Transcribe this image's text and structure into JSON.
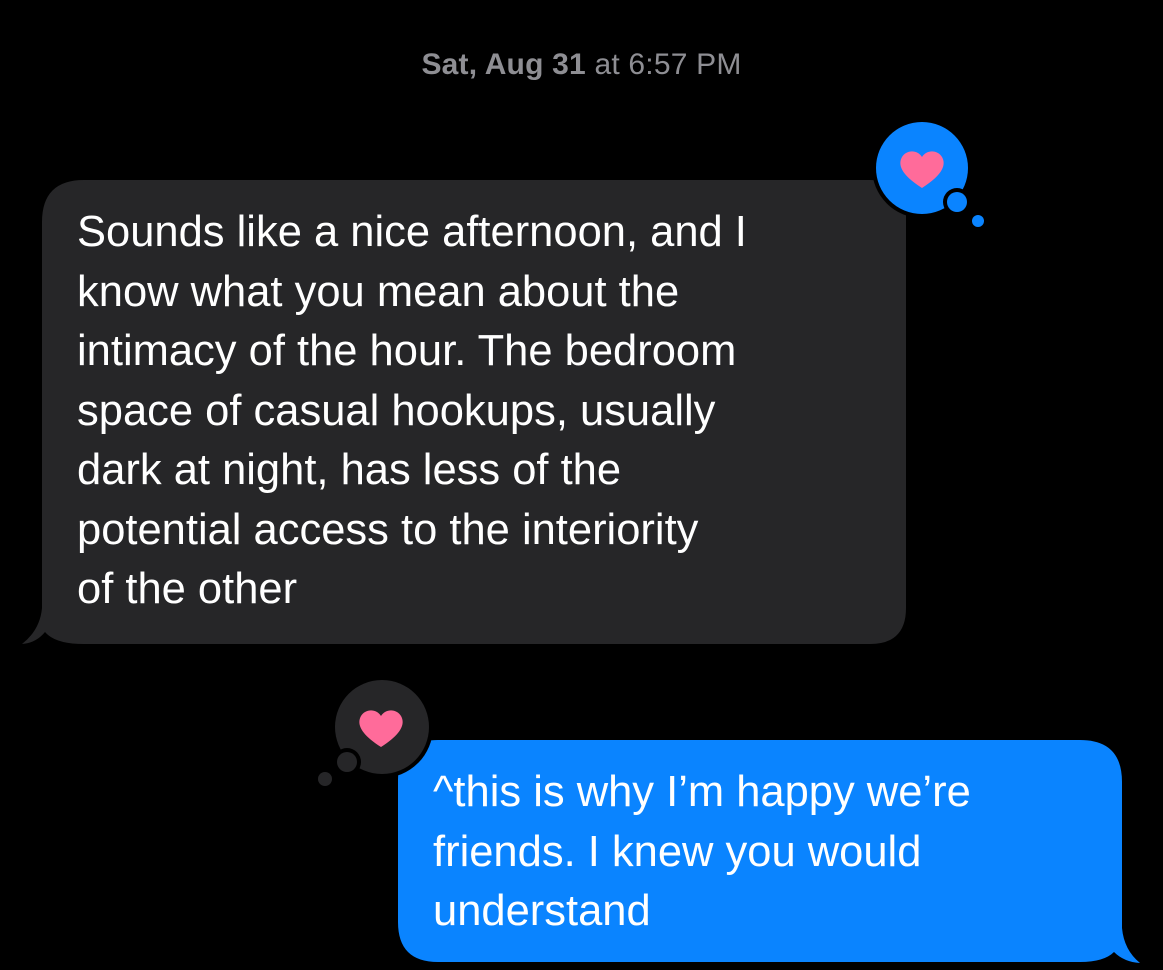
{
  "conversation": {
    "timestamp_day": "Sat, Aug 31",
    "timestamp_time": "at 6:57 PM",
    "messages": [
      {
        "direction": "incoming",
        "text": "Sounds like a nice afternoon, and I\nknow what you mean about the\nintimacy of the hour. The bedroom\nspace of casual hookups, usually\ndark at night, has less of the\npotential access to the interiority\nof the other",
        "reaction": "heart-icon",
        "reaction_by": "me"
      },
      {
        "direction": "outgoing",
        "text": "^this is why I’m happy we’re\nfriends. I knew you would\nunderstand",
        "reaction": "heart-icon",
        "reaction_by": "them"
      }
    ]
  },
  "colors": {
    "background": "#000000",
    "incoming_bubble": "#262628",
    "outgoing_bubble": "#0a84ff",
    "timestamp": "#8e8e93",
    "heart": "#ff6b9a",
    "text": "#ffffff"
  }
}
